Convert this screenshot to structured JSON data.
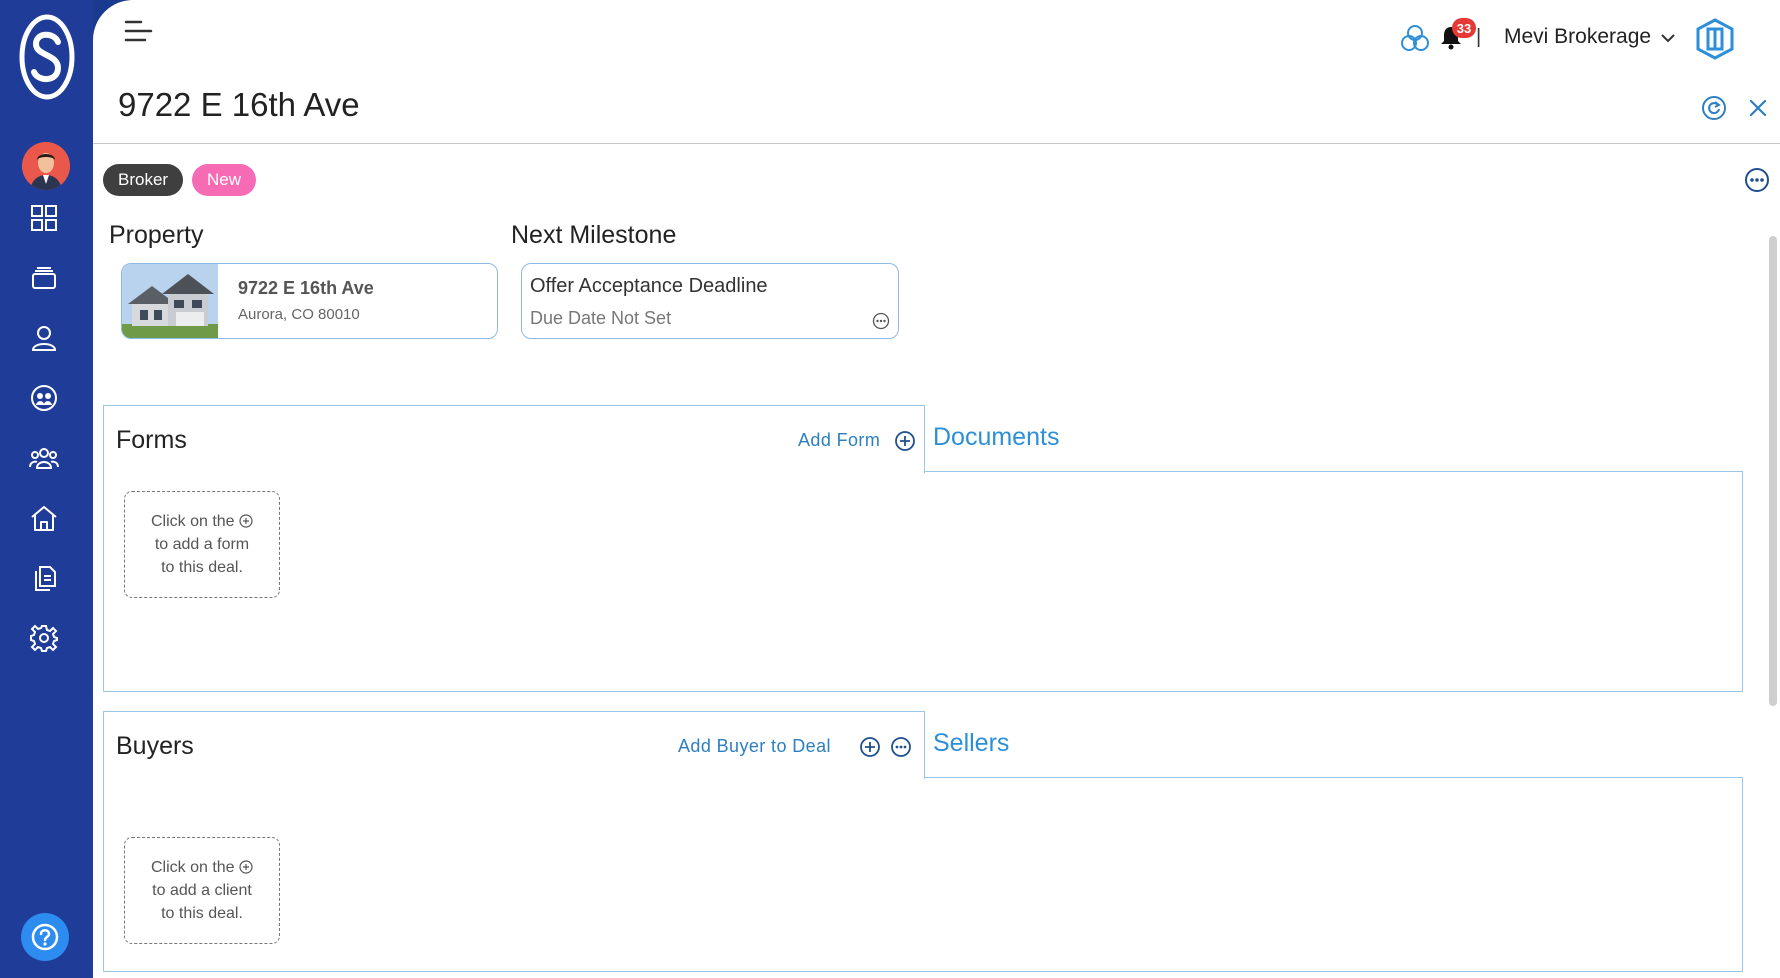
{
  "app": {
    "brokerage_name": "Mevi Brokerage",
    "notifications_count": "33",
    "colors": {
      "sidebar": "#1f3c98",
      "accent": "#2d8fd8",
      "badge_new": "#f76bb5",
      "badge_broker": "#3f3f3f"
    }
  },
  "sidebar": {
    "items": [
      {
        "icon": "dashboard-grid-icon"
      },
      {
        "icon": "deals-stack-icon"
      },
      {
        "icon": "contact-person-icon"
      },
      {
        "icon": "team-circle-icon"
      },
      {
        "icon": "people-group-icon"
      },
      {
        "icon": "home-icon"
      },
      {
        "icon": "documents-icon"
      },
      {
        "icon": "settings-gear-icon"
      }
    ]
  },
  "deal": {
    "title": "9722 E 16th Ave",
    "badges": [
      "Broker",
      "New"
    ]
  },
  "property": {
    "label": "Property",
    "address": "9722 E 16th Ave",
    "city_line": "Aurora,  CO  80010"
  },
  "milestone": {
    "label": "Next Milestone",
    "title": "Offer Acceptance Deadline",
    "due": "Due Date Not Set"
  },
  "forms": {
    "title": "Forms",
    "add_label": "Add Form",
    "tab_other": "Documents",
    "empty_line1": "Click on the",
    "empty_line2": "to add a form",
    "empty_line3": "to this deal."
  },
  "buyers": {
    "title": "Buyers",
    "add_label": "Add Buyer to Deal",
    "tab_other": "Sellers",
    "empty_line1": "Click on the",
    "empty_line2": "to add a client",
    "empty_line3": "to this deal."
  }
}
